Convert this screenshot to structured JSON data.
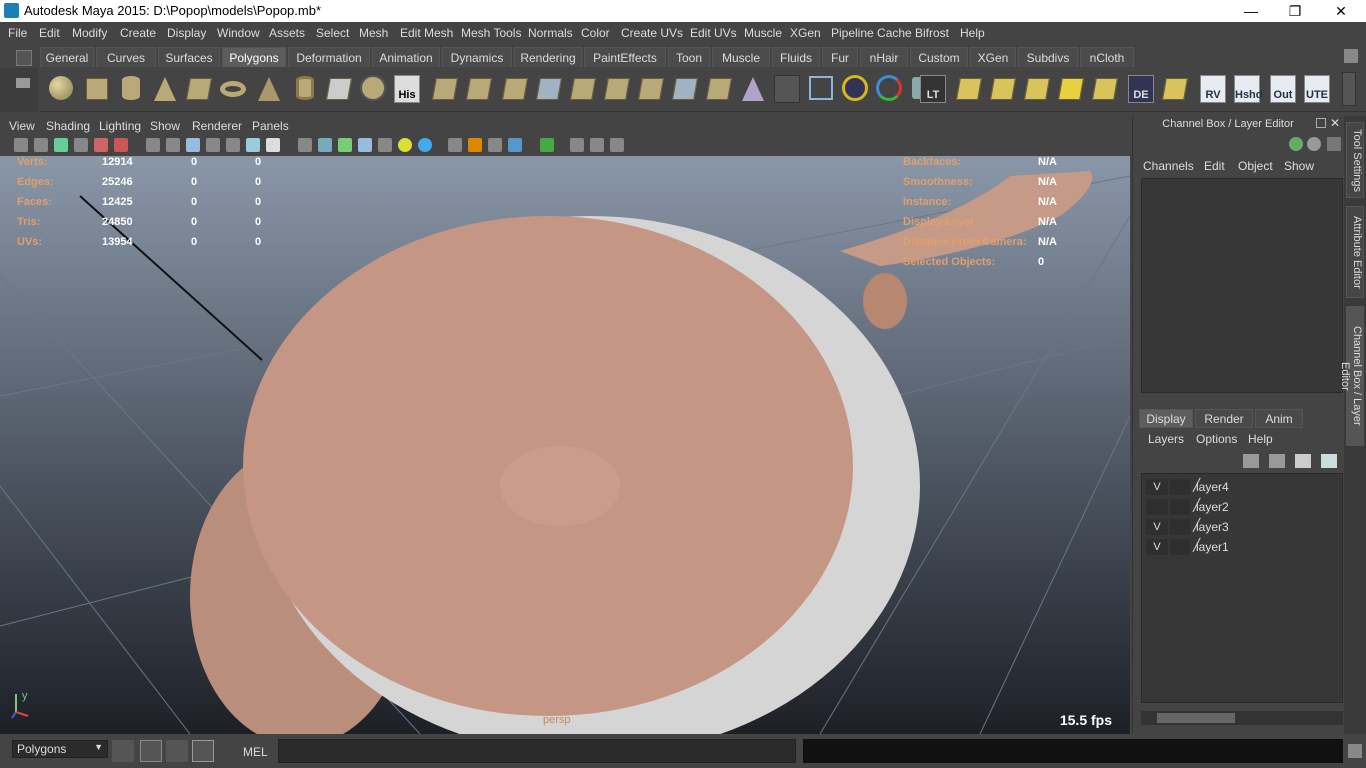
{
  "window": {
    "title": "Autodesk Maya 2015: D:\\Popop\\models\\Popop.mb*",
    "minimize": "—",
    "restore": "❐",
    "close": "✕"
  },
  "menus": [
    "File",
    "Edit",
    "Modify",
    "Create",
    "Display",
    "Window",
    "Assets",
    "Select",
    "Mesh",
    "Edit Mesh",
    "Mesh Tools",
    "Normals",
    "Color",
    "Create UVs",
    "Edit UVs",
    "Muscle",
    "XGen",
    "Pipeline Cache",
    "Bifrost",
    "Help"
  ],
  "shelf_tabs": [
    "General",
    "Curves",
    "Surfaces",
    "Polygons",
    "Deformation",
    "Animation",
    "Dynamics",
    "Rendering",
    "PaintEffects",
    "Toon",
    "Muscle",
    "Fluids",
    "Fur",
    "nHair",
    "Custom",
    "XGen",
    "Subdivs",
    "nCloth"
  ],
  "shelf_labels": {
    "his": "His",
    "lt": "LT",
    "de": "DE",
    "rv": "RV",
    "hshd": "Hshd",
    "out": "Out",
    "ute": "UTE"
  },
  "viewport_menus": [
    "View",
    "Shading",
    "Lighting",
    "Show",
    "Renderer",
    "Panels"
  ],
  "hud_left": [
    {
      "label": "Verts:",
      "a": "12914",
      "b": "0",
      "c": "0"
    },
    {
      "label": "Edges:",
      "a": "25246",
      "b": "0",
      "c": "0"
    },
    {
      "label": "Faces:",
      "a": "12425",
      "b": "0",
      "c": "0"
    },
    {
      "label": "Tris:",
      "a": "24850",
      "b": "0",
      "c": "0"
    },
    {
      "label": "UVs:",
      "a": "13954",
      "b": "0",
      "c": "0"
    }
  ],
  "hud_right": [
    {
      "label": "Backfaces:",
      "value": "N/A"
    },
    {
      "label": "Smoothness:",
      "value": "N/A"
    },
    {
      "label": "Instance:",
      "value": "N/A"
    },
    {
      "label": "Display Layer:",
      "value": "N/A"
    },
    {
      "label": "Distance From Camera:",
      "value": "N/A"
    },
    {
      "label": "Selected Objects:",
      "value": "0"
    }
  ],
  "viewport": {
    "fps": "15.5 fps",
    "camera": "persp",
    "axis_y": "y"
  },
  "channel_box": {
    "title": "Channel Box / Layer Editor",
    "menus": [
      "Channels",
      "Edit",
      "Object",
      "Show"
    ]
  },
  "layer_editor": {
    "tabs": [
      "Display",
      "Render",
      "Anim"
    ],
    "menus": [
      "Layers",
      "Options",
      "Help"
    ],
    "layers": [
      {
        "vis": "V",
        "name": "layer4"
      },
      {
        "vis": "",
        "name": "layer2"
      },
      {
        "vis": "V",
        "name": "layer3"
      },
      {
        "vis": "V",
        "name": "layer1"
      }
    ]
  },
  "side_tabs": [
    "Tool Settings",
    "Attribute Editor",
    "Channel Box / Layer Editor"
  ],
  "command": {
    "mode": "Polygons",
    "mel_label": "MEL"
  },
  "colors": {
    "hud_label": "#e1a06a",
    "skin": "#c89886",
    "diaper": "#d9d9d9"
  }
}
